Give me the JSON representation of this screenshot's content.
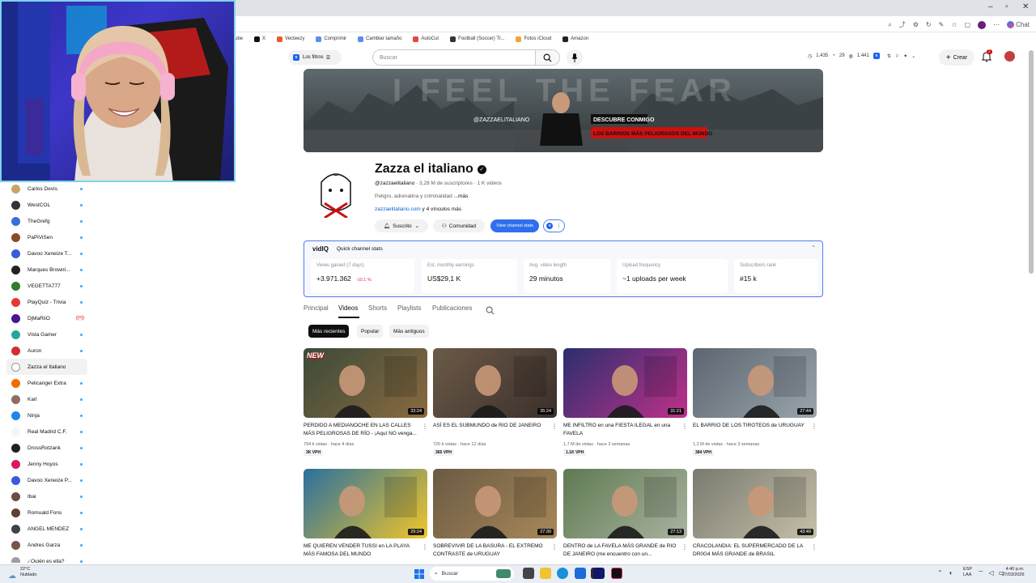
{
  "browser": {
    "bookmarks": [
      {
        "label": "ube",
        "color": "#ff0000"
      },
      {
        "label": "X",
        "color": "#111111"
      },
      {
        "label": "Vecteezy",
        "color": "#f05a28"
      },
      {
        "label": "Comprimir",
        "color": "#5b8def"
      },
      {
        "label": "Cambiar tamaño",
        "color": "#5b8def"
      },
      {
        "label": "AutoCut",
        "color": "#e2483d"
      },
      {
        "label": "Football (Soccer) Tr...",
        "color": "#333333"
      },
      {
        "label": "Fotos iCloud",
        "color": "#f2a33a"
      },
      {
        "label": "Amazon",
        "color": "#222222"
      }
    ],
    "chat_label": "Chat"
  },
  "sidebar": {
    "items": [
      {
        "label": "Carlos Devis",
        "status": "dot",
        "color": "#c9a36b"
      },
      {
        "label": "WestCOL",
        "status": "dot",
        "color": "#333333"
      },
      {
        "label": "TheGrefg",
        "status": "dot",
        "color": "#3a6fd8"
      },
      {
        "label": "PaPiViSen",
        "status": "dot",
        "color": "#8a4a2a"
      },
      {
        "label": "Davoo Xeneize T...",
        "status": "dot",
        "color": "#3b5bdb"
      },
      {
        "label": "Marques Brownl...",
        "status": "dot",
        "color": "#222222"
      },
      {
        "label": "VEGETTA777",
        "status": "dot",
        "color": "#2e7d32"
      },
      {
        "label": "PlayQuiz - Trivia",
        "status": "dot",
        "color": "#e53935"
      },
      {
        "label": "DjMaRiiO",
        "status": "live",
        "color": "#4a148c"
      },
      {
        "label": "Vista Gamer",
        "status": "dot",
        "color": "#26a69a"
      },
      {
        "label": "Auron",
        "status": "dot",
        "color": "#d32f2f"
      },
      {
        "label": "Zazza el Italiano",
        "status": "none",
        "color": "#ffffff"
      },
      {
        "label": "Pelicanger Extra",
        "status": "dot",
        "color": "#ef6c00"
      },
      {
        "label": "Karl",
        "status": "dot",
        "color": "#8d6e63"
      },
      {
        "label": "Ninja",
        "status": "dot",
        "color": "#1e88e5"
      },
      {
        "label": "Real Madrid C.F.",
        "status": "dot",
        "color": "#f5f5f5"
      },
      {
        "label": "DrossRotzank",
        "status": "dot",
        "color": "#212121"
      },
      {
        "label": "Jenny Hoyos",
        "status": "dot",
        "color": "#d81b60"
      },
      {
        "label": "Davoo Xeneize P...",
        "status": "dot",
        "color": "#3b5bdb"
      },
      {
        "label": "Ibai",
        "status": "dot",
        "color": "#6d4c41"
      },
      {
        "label": "Romuald Fons",
        "status": "dot",
        "color": "#5d4037"
      },
      {
        "label": "ANGEL MENDEZ",
        "status": "dot",
        "color": "#424242"
      },
      {
        "label": "Andres Garza",
        "status": "dot",
        "color": "#795548"
      },
      {
        "label": "¿Quién es ella?",
        "status": "dot",
        "color": "#9e9e9e"
      }
    ],
    "live_icon": "((•))"
  },
  "header": {
    "filter_label": "Los filtros",
    "search_placeholder": "Buscar",
    "stats": [
      "1.435",
      "29",
      "1.441"
    ],
    "create_label": "Crear",
    "notif_count": "2"
  },
  "banner": {
    "big_text": "I FEEL THE FEAR",
    "handle": "@ZAZZAELITALIANO",
    "line1": "DESCUBRE CONMIGO",
    "line2": "LOS BARRIOS MÁS PELIGROSOS DEL MUNDO"
  },
  "channel": {
    "name": "Zazza el italiano",
    "verified": "✓",
    "handle": "@zazzaelitaliano",
    "subscribers": "3,28 M de suscriptores",
    "videos_count": "1 K videos",
    "desc_prefix": "Peligro, adrenalina y criminalidad ",
    "desc_more": "...más",
    "link": "zazzaelitaliano.com",
    "link_more": "y 4 vínculos más",
    "subscribed_label": "Suscrito",
    "community_label": "Comunidad",
    "view_stats_label": "View channel stats"
  },
  "vidiq": {
    "title": "Quick channel stats",
    "logo": "vidIQ",
    "cards": [
      {
        "label": "Views gained (7 days)",
        "value": "+3.971.362",
        "pct": "-10.1 %"
      },
      {
        "label": "Est. monthly earnings",
        "value": "US$29,1 K",
        "pct": ""
      },
      {
        "label": "Avg. video length",
        "value": "29 minutos",
        "pct": ""
      },
      {
        "label": "Upload frequency",
        "value": "~1 uploads per week",
        "pct": ""
      },
      {
        "label": "Subscribers rank",
        "value": "#15 k",
        "pct": ""
      }
    ]
  },
  "tabs": [
    "Principal",
    "Videos",
    "Shorts",
    "Playlists",
    "Publicaciones"
  ],
  "sort": [
    "Más recientes",
    "Popular",
    "Más antiguos"
  ],
  "videos": [
    {
      "title": "PERDIDO A MEDIANOCHE EN LAS CALLES MÁS PELIGROSAS DE RÍO - ¡Aquí NO venga...",
      "meta": "794 k vistas · hace 4 días",
      "duration": "33:24",
      "vph": "3K VPH",
      "badge": "NEW",
      "c1": "#3b4a3a",
      "c2": "#8a6a3f"
    },
    {
      "title": "ASÍ ES EL SUBMUNDO de RIO DE JANEIRO",
      "meta": "720 k vistas · hace 12 días",
      "duration": "35:24",
      "vph": "365 VPH",
      "badge": "",
      "c1": "#6b5a48",
      "c2": "#3a2f2a"
    },
    {
      "title": "ME INFILTRO en una FIESTA ILEGAL en una FAVELA",
      "meta": "1,7 M de vistas · hace 2 semanas",
      "duration": "31:21",
      "vph": "1.1K VPH",
      "badge": "",
      "c1": "#2a2f6e",
      "c2": "#c0308a"
    },
    {
      "title": "EL BARRIO DE LOS TIROTEOS de URUGUAY",
      "meta": "1,2 M de vistas · hace 3 semanas",
      "duration": "27:44",
      "vph": "384 VPH",
      "badge": "",
      "c1": "#5c6670",
      "c2": "#9aa4ac"
    },
    {
      "title": "ME QUIEREN VENDER TUSSI en LA PLAYA MÁS FAMOSA DEL MUNDO",
      "meta": "",
      "duration": "29:24",
      "vph": "",
      "badge": "",
      "c1": "#2a6f9e",
      "c2": "#f0c62a"
    },
    {
      "title": "SOBREVIVIR DE LA BASURA - EL EXTREMO CONTRASTE de URUGUAY",
      "meta": "",
      "duration": "27:30",
      "vph": "",
      "badge": "",
      "c1": "#6a5a44",
      "c2": "#a88858"
    },
    {
      "title": "DENTRO de LA FAVELA MÁS GRANDE de RIO DE JANEIRO (me encuentro con un...",
      "meta": "",
      "duration": "27:13",
      "vph": "",
      "badge": "",
      "c1": "#5e7a52",
      "c2": "#aab3a0"
    },
    {
      "title": "CRACOLANDIA: EL SUPERMERCADO DE LA DR0G4 MÁS GRANDE de BRASIL",
      "meta": "",
      "duration": "43:49",
      "vph": "",
      "badge": "",
      "c1": "#7a7a70",
      "c2": "#c6c0a8"
    }
  ],
  "taskbar": {
    "weather_temp": "22°C",
    "weather_desc": "Nublado",
    "search": "Buscar",
    "lang": "ESP",
    "region": "LAA",
    "time": "4:40 p.m.",
    "date": "27/03/2026"
  }
}
